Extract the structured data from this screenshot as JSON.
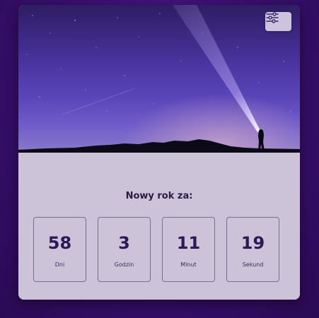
{
  "settings_icon": "sliders-icon",
  "countdown": {
    "title": "Nowy rok za:",
    "units": [
      {
        "value": "58",
        "label": "Dni"
      },
      {
        "value": "3",
        "label": "Godzin"
      },
      {
        "value": "11",
        "label": "Minut"
      },
      {
        "value": "19",
        "label": "Sekund"
      }
    ]
  },
  "colors": {
    "background": "#3a1070",
    "card": "#cdc3d9",
    "text": "#2b1a55"
  }
}
